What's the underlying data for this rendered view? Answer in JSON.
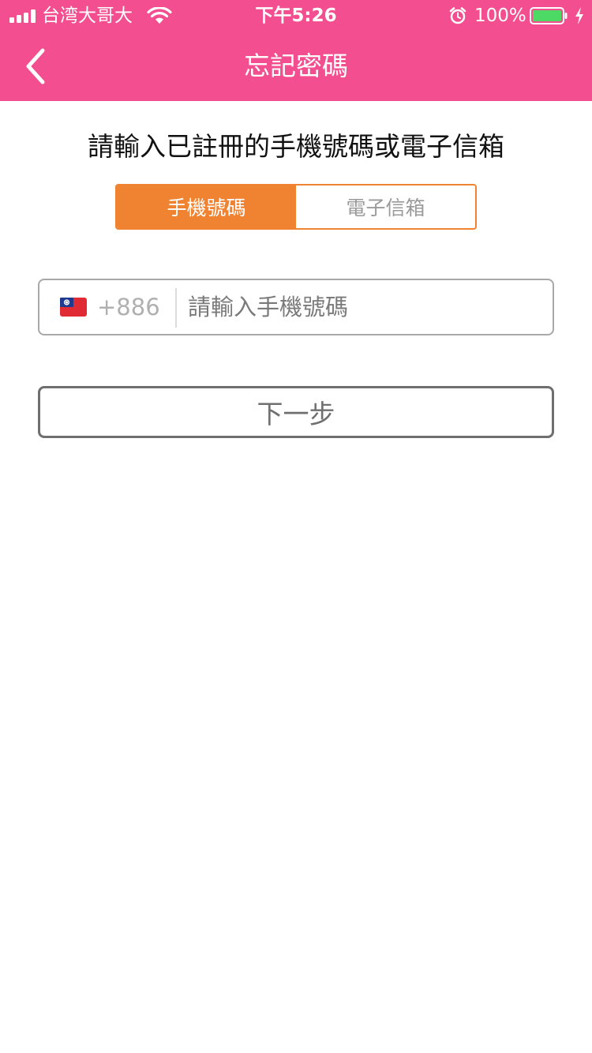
{
  "status_bar": {
    "carrier": "台湾大哥大",
    "time": "下午5:26",
    "battery_percent": "100%",
    "battery_level": 1.0,
    "icons": [
      "signal-icon",
      "wifi-icon",
      "alarm-icon",
      "battery-icon",
      "charging-icon"
    ]
  },
  "nav": {
    "title": "忘記密碼",
    "back_icon": "chevron-left-icon"
  },
  "instruction": "請輸入已註冊的手機號碼或電子信箱",
  "tabs": [
    {
      "label": "手機號碼",
      "selected": true
    },
    {
      "label": "電子信箱",
      "selected": false
    }
  ],
  "phone": {
    "flag_icon": "taiwan-flag-icon",
    "country_code": "+886",
    "placeholder": "請輸入手機號碼",
    "value": ""
  },
  "next_button": "下一步",
  "colors": {
    "header": "#f34e8f",
    "accent": "#ef8331",
    "button_border": "#6f6f6f"
  }
}
